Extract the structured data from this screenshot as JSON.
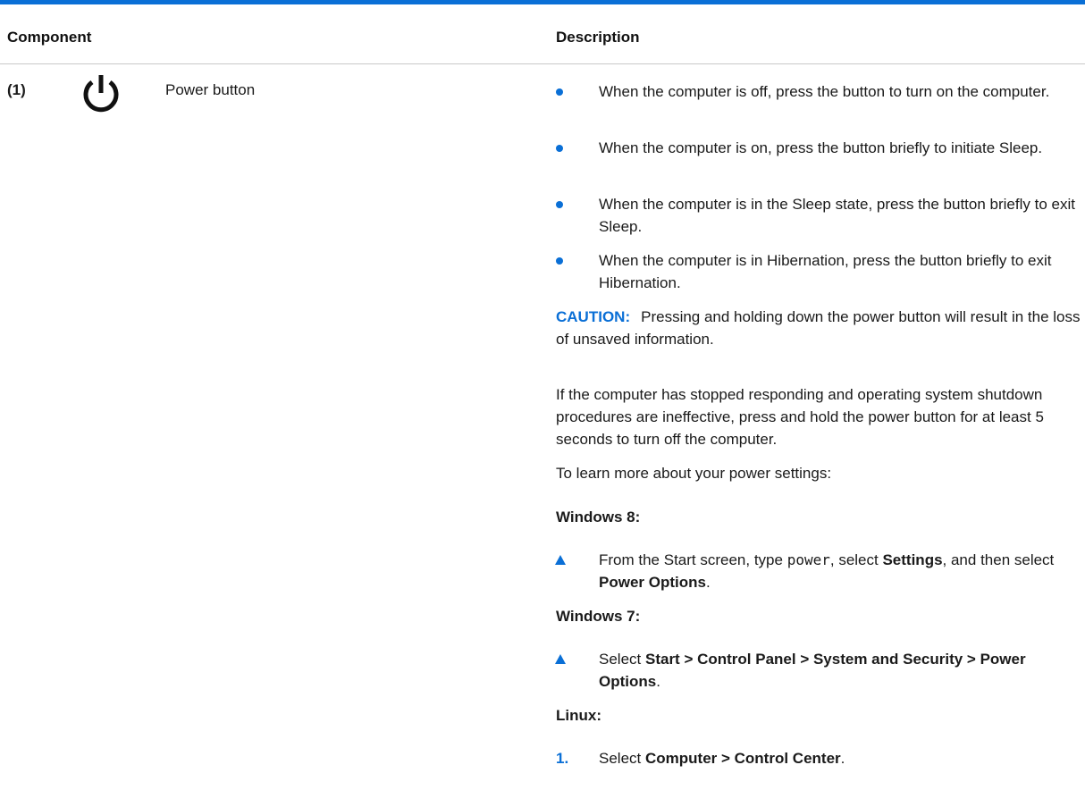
{
  "table": {
    "header": {
      "component": "Component",
      "description": "Description"
    },
    "row": {
      "number": "(1)",
      "icon": "power-icon",
      "component_name": "Power button",
      "bullets": [
        "When the computer is off, press the button to turn on the computer.",
        "When the computer is on, press the button briefly to initiate Sleep.",
        "When the computer is in the Sleep state, press the button briefly to exit Sleep.",
        "When the computer is in Hibernation, press the button briefly to exit Hibernation."
      ],
      "caution": {
        "label": "CAUTION:",
        "text": "Pressing and holding down the power button will result in the loss of unsaved information."
      },
      "paragraph_unresponsive": "If the computer has stopped responding and operating system shutdown procedures are ineffective, press and hold the power button for at least 5 seconds to turn off the computer.",
      "paragraph_learn_more": "To learn more about your power settings:",
      "windows8": {
        "heading": "Windows 8:",
        "step_part1": "From the Start screen, type ",
        "step_code": "power",
        "step_part2": ", select ",
        "step_bold1": "Settings",
        "step_part3": ", and then select ",
        "step_bold2": "Power Options",
        "step_end": "."
      },
      "windows7": {
        "heading": "Windows 7:",
        "step_part1": "Select ",
        "step_bold": "Start > Control Panel > System and Security > Power Options",
        "step_end": "."
      },
      "linux": {
        "heading": "Linux:",
        "step_number": "1.",
        "step_part1": "Select ",
        "step_bold": "Computer > Control Center",
        "step_end": "."
      }
    }
  },
  "colors": {
    "accent": "#0a6fd6",
    "rule": "#c8c8c8",
    "text": "#1a1a1a"
  }
}
